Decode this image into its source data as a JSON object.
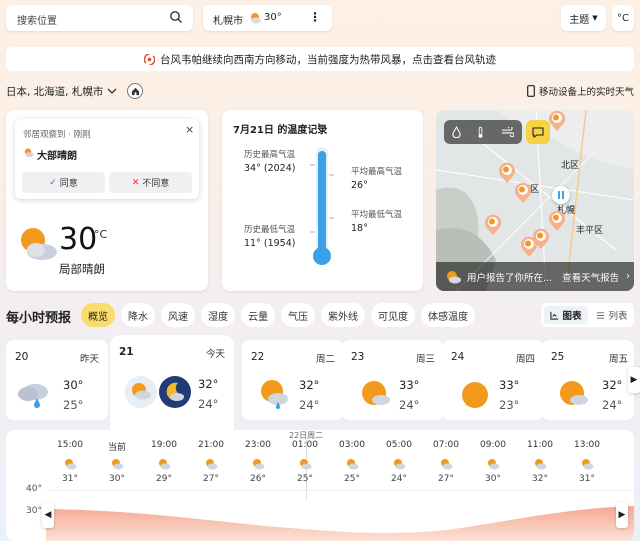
{
  "top": {
    "search_placeholder": "搜索位置",
    "location_pill": {
      "city": "札幌市",
      "temp": "30°"
    },
    "theme_label": "主题",
    "unit_label": "°C"
  },
  "alert": {
    "text": "台风韦帕继续向西南方向移动，当前强度为热带风暴，点击查看台风轨迹"
  },
  "location": {
    "path": "日本, 北海道, 札幌市",
    "mobile_label": "移动设备上的实时天气"
  },
  "observation": {
    "popup": {
      "title": "邻居观察到 · 刚刚",
      "condition": "大部晴朗",
      "agree": "同意",
      "disagree": "不同意"
    },
    "temp": "30",
    "unit": "°C",
    "condition": "局部晴朗"
  },
  "record": {
    "title": "7月21日 的温度记录",
    "hist_high_label": "历史最高气温",
    "hist_high_value": "34° (2024)",
    "hist_low_label": "历史最低气温",
    "hist_low_value": "11° (1954)",
    "avg_high_label": "平均最高气温",
    "avg_high_value": "26°",
    "avg_low_label": "平均最低气温",
    "avg_low_value": "18°"
  },
  "map": {
    "labels": {
      "north": "北区",
      "west": "西区",
      "city": "札幌",
      "south": "丰平区"
    },
    "report_text": "用户报告了你所在...",
    "report_link": "查看天气报告"
  },
  "hourly": {
    "title": "每小时预报",
    "chips": [
      "概览",
      "降水",
      "风速",
      "湿度",
      "云量",
      "气压",
      "紫外线",
      "可见度",
      "体感温度"
    ],
    "view_chart": "图表",
    "view_list": "列表"
  },
  "days": [
    {
      "date": "20",
      "weekday": "昨天",
      "high": "30°",
      "low": "25°",
      "icon": "rain-cloud-icon"
    },
    {
      "date": "21",
      "weekday": "今天",
      "high": "32°",
      "low": "24°",
      "icon": "partly-sunny-icon"
    },
    {
      "date": "22",
      "weekday": "周二",
      "high": "32°",
      "low": "24°",
      "icon": "sun-rain-icon"
    },
    {
      "date": "23",
      "weekday": "周三",
      "high": "33°",
      "low": "24°",
      "icon": "partly-sunny-icon"
    },
    {
      "date": "24",
      "weekday": "周四",
      "high": "33°",
      "low": "23°",
      "icon": "sunny-icon"
    },
    {
      "date": "25",
      "weekday": "周五",
      "high": "32°",
      "low": "24°",
      "icon": "partly-sunny-icon"
    }
  ],
  "hours": {
    "day_marker": "22日周二",
    "columns": [
      {
        "time": "15:00",
        "temp": "31°"
      },
      {
        "time": "当前",
        "temp": "30°"
      },
      {
        "time": "19:00",
        "temp": "29°"
      },
      {
        "time": "21:00",
        "temp": "27°"
      },
      {
        "time": "23:00",
        "temp": "26°"
      },
      {
        "time": "01:00",
        "temp": "25°"
      },
      {
        "time": "03:00",
        "temp": "25°"
      },
      {
        "time": "05:00",
        "temp": "24°"
      },
      {
        "time": "07:00",
        "temp": "27°"
      },
      {
        "time": "09:00",
        "temp": "30°"
      },
      {
        "time": "11:00",
        "temp": "32°"
      },
      {
        "time": "13:00",
        "temp": "31°"
      }
    ],
    "axis": [
      "40°",
      "30°"
    ]
  },
  "colors": {
    "accent_yellow": "#f9dc6a",
    "thermo_blue": "#3aa0e8",
    "sun_orange": "#f39a1c"
  }
}
